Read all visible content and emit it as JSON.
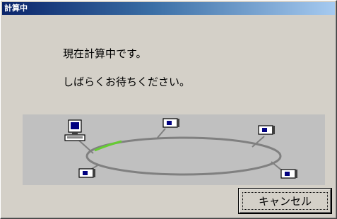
{
  "window": {
    "title": "計算中"
  },
  "messages": {
    "line1": "現在計算中です。",
    "line2": "しばらくお待ちください。"
  },
  "network": {
    "ring_color": "#808080",
    "progress_color": "#66cc33",
    "nodes": [
      "computer-icon",
      "device-icon",
      "device-icon",
      "device-icon",
      "device-icon"
    ]
  },
  "buttons": {
    "cancel_label": "キャンセル"
  }
}
